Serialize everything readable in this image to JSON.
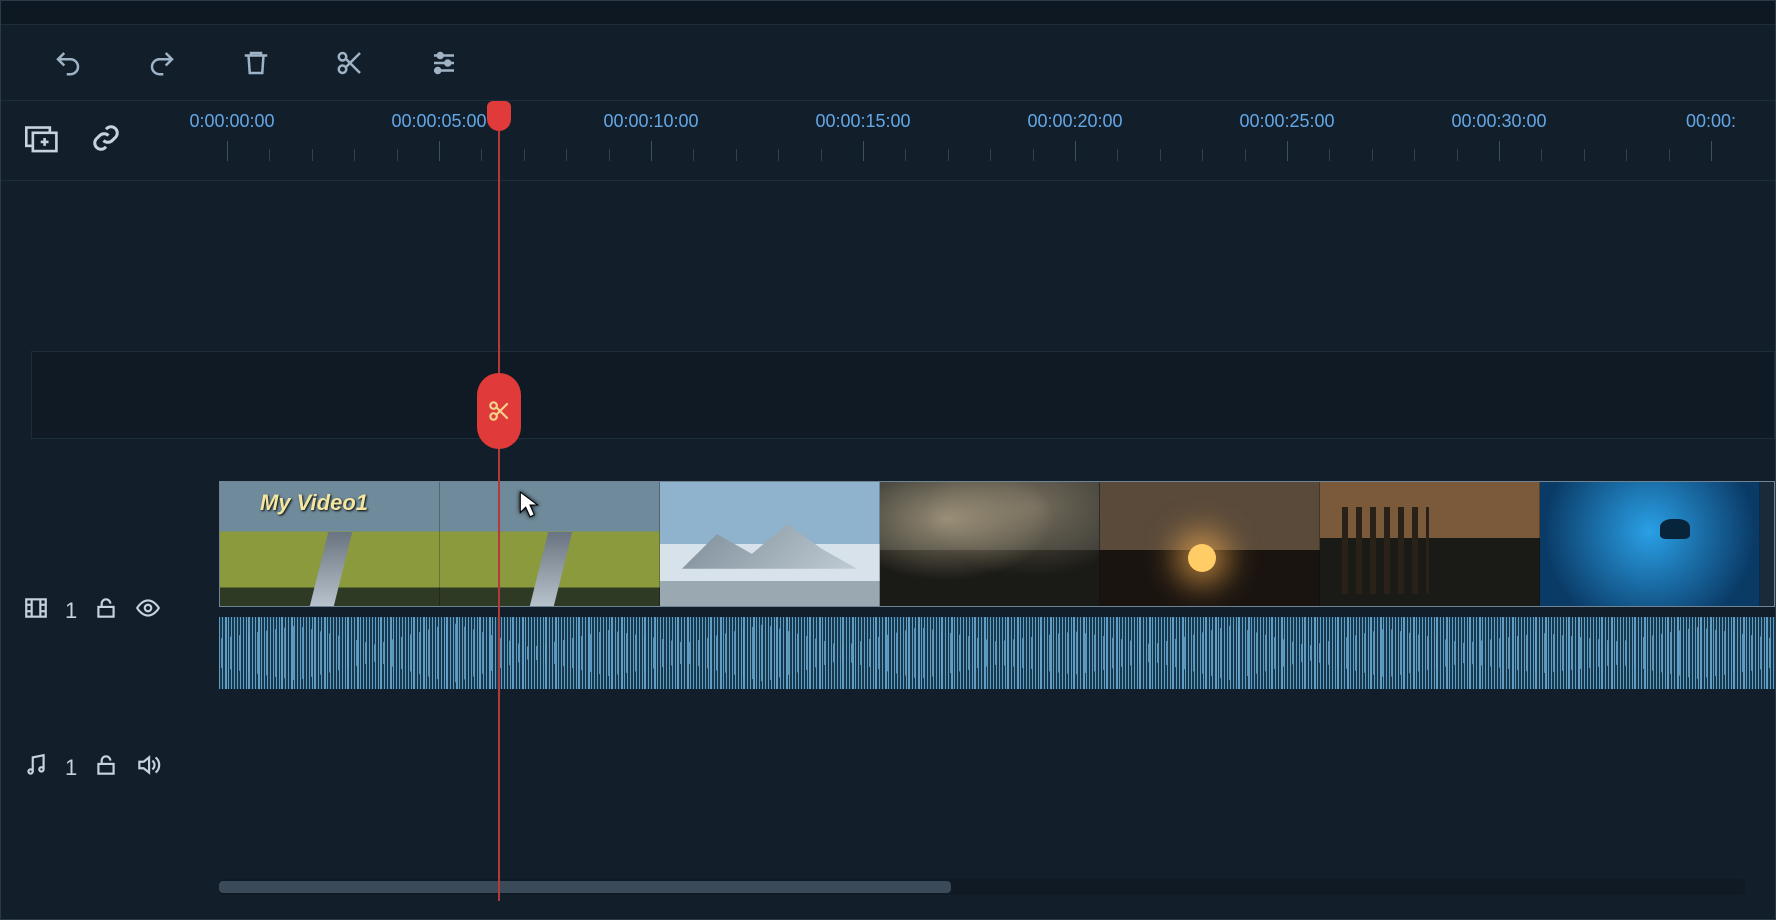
{
  "toolbar": {
    "undo": "undo",
    "redo": "redo",
    "delete": "delete",
    "split": "split",
    "settings": "settings"
  },
  "ruler": {
    "ticks": [
      "00:00:00:00",
      "00:00:05:00",
      "00:00:10:00",
      "00:00:15:00",
      "00:00:20:00",
      "00:00:25:00",
      "00:00:30:00",
      "00:00:"
    ],
    "spacing_px": 212,
    "minors_per_major": 5
  },
  "playhead": {
    "time": "00:00:05:00",
    "cut_tool_visible": true
  },
  "tracks": {
    "video": {
      "index": "1",
      "locked": false,
      "visible": true,
      "clip_label": "My Video1"
    },
    "audio": {
      "index": "1",
      "locked": false,
      "audible": true
    }
  },
  "scrollbar": {
    "position_pct": 0,
    "extent_pct": 48
  }
}
